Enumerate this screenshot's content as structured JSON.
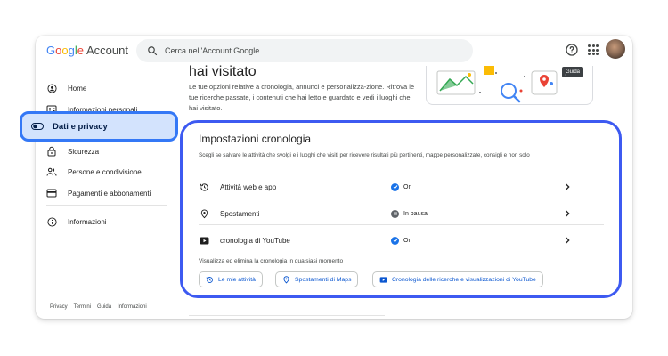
{
  "header": {
    "logo": {
      "letters": [
        "G",
        "o",
        "o",
        "g",
        "l",
        "e"
      ],
      "suffix": "Account"
    },
    "search_placeholder": "Cerca nell'Account Google",
    "help_tooltip": "Guida",
    "icons": {
      "search": "search-icon",
      "help": "help-circle-icon",
      "apps": "apps-grid-icon"
    }
  },
  "sidebar": {
    "items": [
      {
        "label": "Home",
        "icon": "home-icon"
      },
      {
        "label": "Informazioni personali",
        "icon": "id-card-icon"
      },
      {
        "label": "Dati e privacy",
        "icon": "toggle-icon"
      },
      {
        "label": "Sicurezza",
        "icon": "lock-icon"
      },
      {
        "label": "Persone e condivisione",
        "icon": "people-icon"
      },
      {
        "label": "Pagamenti e abbonamenti",
        "icon": "credit-card-icon"
      },
      {
        "label": "Informazioni",
        "icon": "info-icon"
      }
    ],
    "footer": [
      "Privacy",
      "Termini",
      "Guida",
      "Informazioni"
    ]
  },
  "main": {
    "section_title": "hai visitato",
    "intro": "Le tue opzioni relative a cronologia, annunci e personalizza-zione. Ritrova le tue ricerche passate, i contenuti che hai letto e guardato e vedi i luoghi che hai visitato."
  },
  "history_card": {
    "title": "Impostazioni cronologia",
    "description": "Scegli se salvare le attività che svolgi e i luoghi che visiti per ricevere risultati più pertinenti, mappe personalizzate, consigli e non solo",
    "rows": [
      {
        "label": "Attività web e app",
        "status": "On",
        "status_color": "#1a73e8",
        "icon": "history-icon"
      },
      {
        "label": "Spostamenti",
        "status": "In pausa",
        "status_color": "#5f6368",
        "icon": "location-pin-icon"
      },
      {
        "label": "cronologia di YouTube",
        "status": "On",
        "status_color": "#1a73e8",
        "icon": "youtube-icon"
      }
    ],
    "manage_text": "Visualizza ed elimina la cronologia in qualsiasi momento",
    "chips": [
      {
        "label": "Le mie attività",
        "icon": "history-icon"
      },
      {
        "label": "Spostamenti di Maps",
        "icon": "location-pin-icon"
      },
      {
        "label": "Cronologia delle ricerche e visualizzazioni di YouTube",
        "icon": "youtube-icon"
      }
    ]
  },
  "colors": {
    "accent": "#1a73e8",
    "highlight_border": "#3d5af1",
    "selected_nav_bg": "#d3e3fd"
  }
}
